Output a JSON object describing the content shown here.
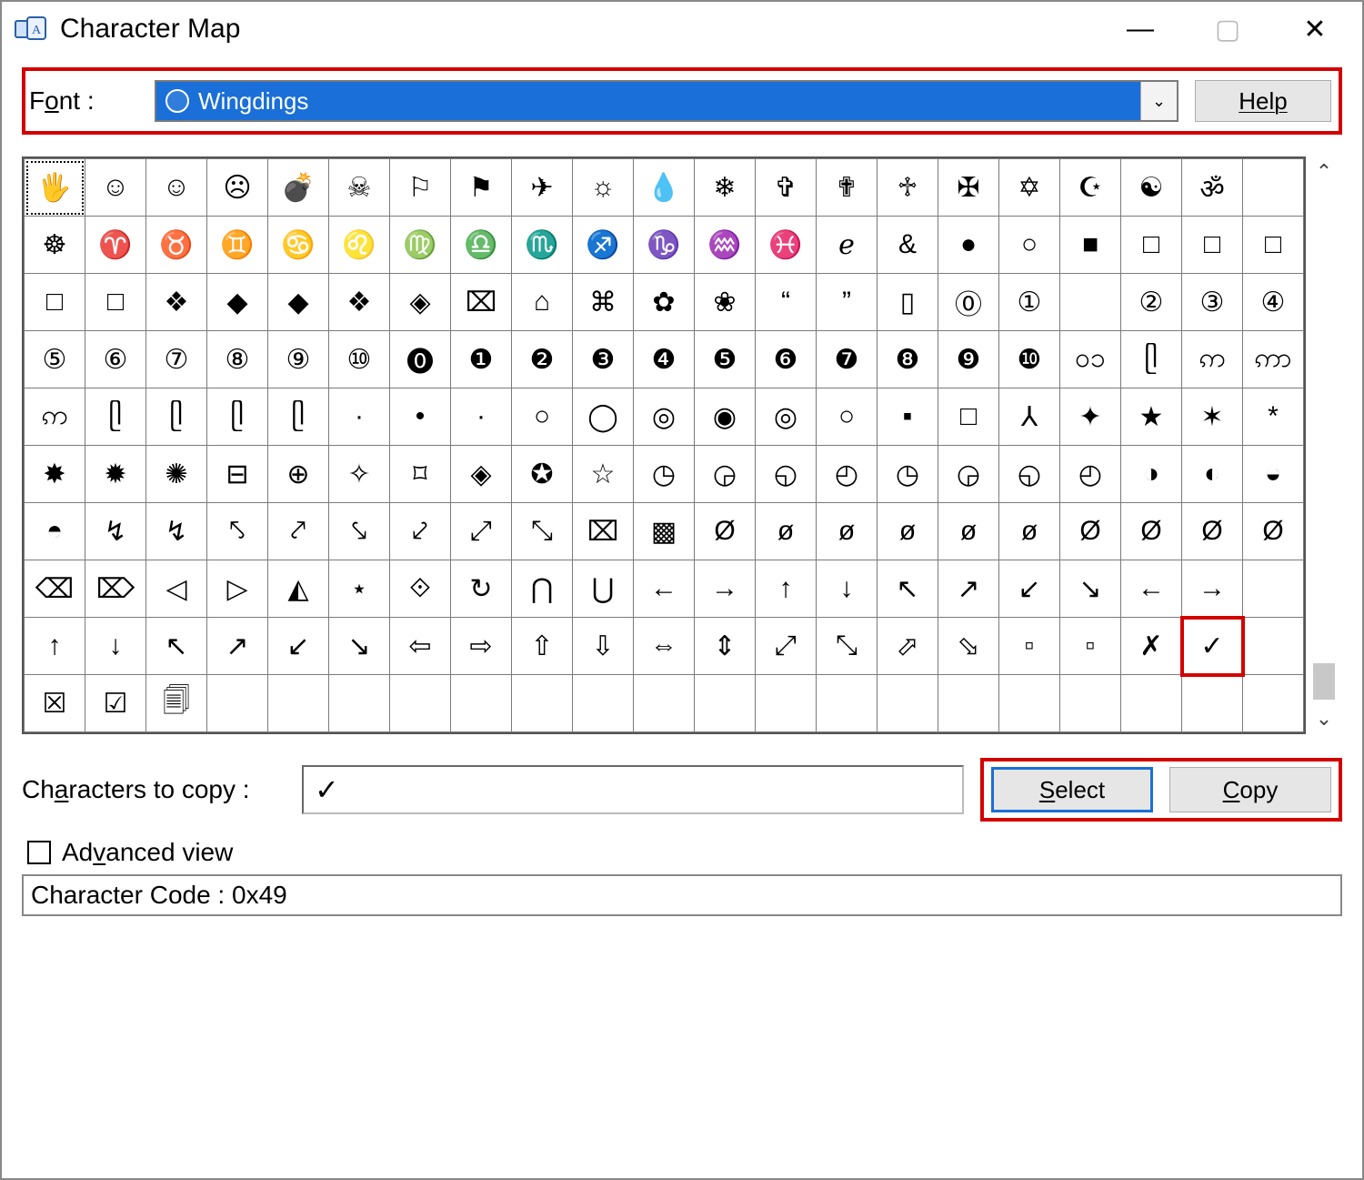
{
  "window": {
    "title": "Character Map"
  },
  "font": {
    "label_pre": "F",
    "label_u": "o",
    "label_post": "nt :",
    "selected": "Wingdings"
  },
  "help_label": "Help",
  "grid": {
    "cols": 21,
    "rows": [
      [
        "🖐",
        "☺",
        "☺",
        "☹",
        "💣",
        "☠",
        "⚐",
        "⚑",
        "✈",
        "☼",
        "💧",
        "❄",
        "✞",
        "✟",
        "♱",
        "✠",
        "✡",
        "☪",
        "☯",
        "ॐ",
        " "
      ],
      [
        "☸",
        "♈",
        "♉",
        "♊",
        "♋",
        "♌",
        "♍",
        "♎",
        "♏",
        "♐",
        "♑",
        "♒",
        "♓",
        "ℯ",
        "&",
        "●",
        "○",
        "■",
        "□",
        "□",
        "□"
      ],
      [
        "□",
        "□",
        "❖",
        "◆",
        "◆",
        "❖",
        "◈",
        "⌧",
        "⌂",
        "⌘",
        "✿",
        "❀",
        "“",
        "”",
        "▯",
        "⓪",
        "①",
        "",
        "②",
        "③",
        "④"
      ],
      [
        "⑤",
        "⑥",
        "⑦",
        "⑧",
        "⑨",
        "⑩",
        "⓿",
        "❶",
        "❷",
        "❸",
        "❹",
        "❺",
        "❻",
        "❼",
        "❽",
        "❾",
        "❿",
        "၀၁",
        "ᥫ",
        "ဢ",
        "ဢာ"
      ],
      [
        "ဢ",
        "ᥫ",
        "ᥫ",
        "ᥫ",
        "ᥫ",
        "·",
        "•",
        "∙",
        "○",
        "◯",
        "◎",
        "◉",
        "◎",
        "○",
        "▪",
        "□",
        "⅄",
        "✦",
        "★",
        "✶",
        "*"
      ],
      [
        "✸",
        "✹",
        "✺",
        "⊟",
        "⊕",
        "✧",
        "⌑",
        "◈",
        "✪",
        "☆",
        "◷",
        "◶",
        "◵",
        "◴",
        "◷",
        "◶",
        "◵",
        "◴",
        "◑",
        "◐",
        "◒"
      ],
      [
        "◓",
        "↯",
        "↯",
        "⤣",
        "⤤",
        "⤥",
        "⤦",
        "⤢",
        "⤡",
        "⌧",
        "▩",
        "Ø",
        "ø",
        "ø",
        "ø",
        "ø",
        "ø",
        "Ø",
        "Ø",
        "Ø",
        "Ø"
      ],
      [
        "⌫",
        "⌦",
        "◁",
        "▷",
        "◭",
        "⋆",
        "⟐",
        "↻",
        "⋂",
        "⋃",
        "←",
        "→",
        "↑",
        "↓",
        "↖",
        "↗",
        "↙",
        "↘",
        "←",
        "→",
        ""
      ],
      [
        "↑",
        "↓",
        "↖",
        "↗",
        "↙",
        "↘",
        "⇦",
        "⇨",
        "⇧",
        "⇩",
        "⇔",
        "⇕",
        "⤢",
        "⤡",
        "⬀",
        "⬂",
        "▫",
        "▫",
        "✗",
        "✓",
        ""
      ],
      [
        "☒",
        "☑",
        "🗐",
        "",
        "",
        "",
        "",
        "",
        "",
        "",
        "",
        "",
        "",
        "",
        "",
        "",
        "",
        "",
        "",
        "",
        ""
      ]
    ],
    "selected_cell": [
      0,
      0
    ],
    "highlight_cell": [
      8,
      19
    ]
  },
  "copy": {
    "label_pre": "Ch",
    "label_u": "a",
    "label_post": "racters to copy :",
    "value": "✓"
  },
  "buttons": {
    "select": "Select",
    "copy": "Copy"
  },
  "advanced": {
    "label_pre": "Ad",
    "label_u": "v",
    "label_post": "anced view",
    "checked": false
  },
  "status": "Character Code : 0x49"
}
